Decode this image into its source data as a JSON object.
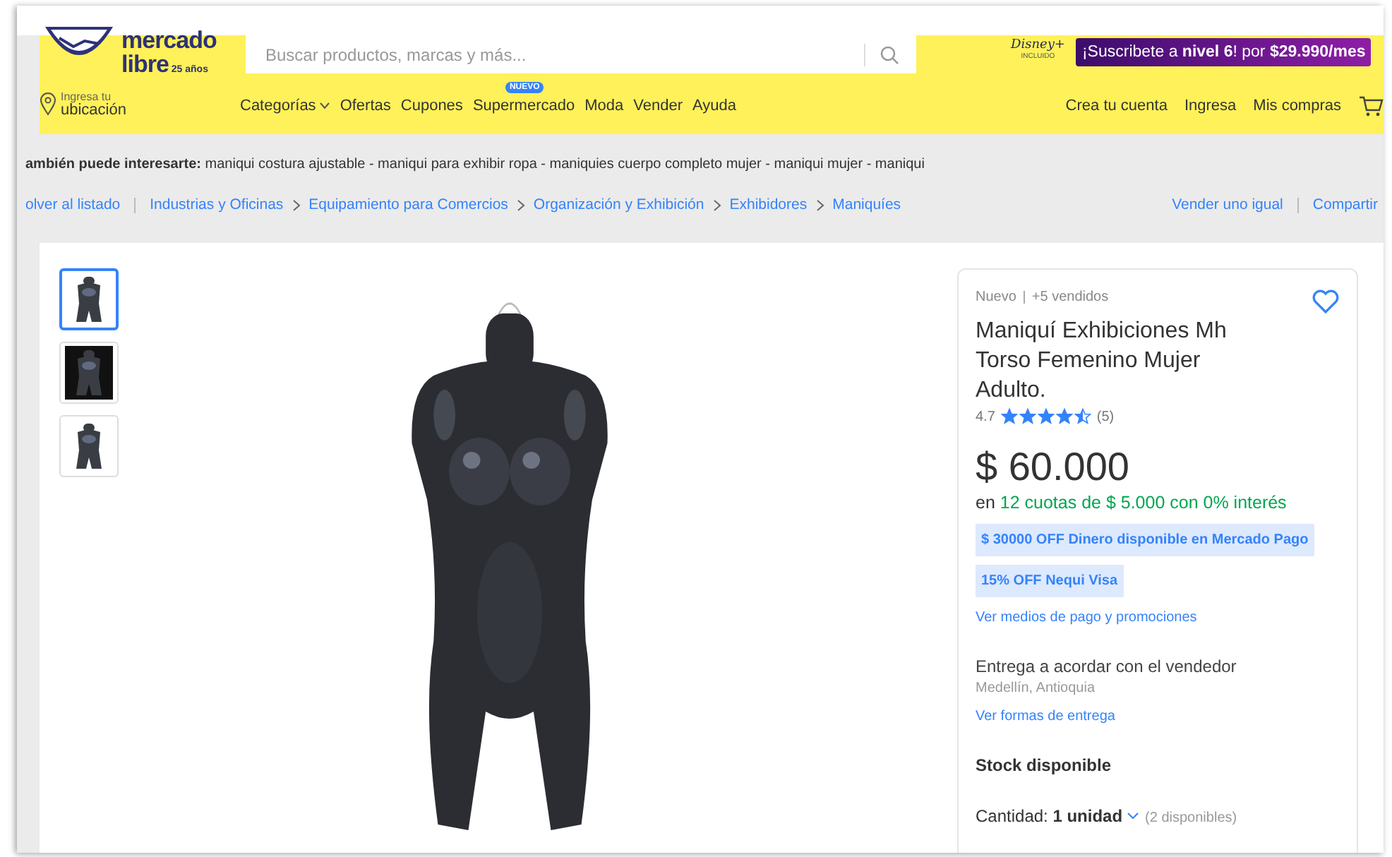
{
  "header": {
    "logo": {
      "line1": "mercado",
      "line2": "libre",
      "tag": "25 años"
    },
    "search": {
      "placeholder": "Buscar productos, marcas y más..."
    },
    "disney": {
      "name": "Disney+",
      "note": "INCLUIDO"
    },
    "subscribe": "¡Suscribete a **nivel 6**! por **$29.990/mes**",
    "location": {
      "line1": "Ingresa tu",
      "line2": "ubicación"
    },
    "nav": [
      {
        "label": "Categorías",
        "kind": "menu"
      },
      {
        "label": "Ofertas",
        "kind": "link"
      },
      {
        "label": "Cupones",
        "kind": "link"
      },
      {
        "label": "Supermercado",
        "kind": "badge",
        "badge": "NUEVO"
      },
      {
        "label": "Moda",
        "kind": "link"
      },
      {
        "label": "Vender",
        "kind": "link"
      },
      {
        "label": "Ayuda",
        "kind": "link"
      }
    ],
    "account": [
      "Crea tu cuenta",
      "Ingresa",
      "Mis compras"
    ]
  },
  "related": "**ambién puede interesarte:** maniqui costura ajustable - maniqui para exhibir ropa - maniquies cuerpo completo mujer - maniqui mujer - maniqui",
  "breadcrumb": {
    "back": "olver al listado",
    "path": [
      "Industrias y Oficinas",
      "Equipamiento para Comercios",
      "Organización y Exhibición",
      "Exhibidores",
      "Maniquíes"
    ],
    "actions": [
      "Vender uno igual",
      "Compartir"
    ]
  },
  "gallery": {
    "thumbnails": [
      {
        "kind": "picture",
        "selected": true
      },
      {
        "kind": "picture",
        "selected": false
      },
      {
        "kind": "picture",
        "selected": false
      }
    ]
  },
  "product": {
    "condition": "Nuevo",
    "sold": "+5 vendidos",
    "title": "Maniquí Exhibiciones Mh Torso Femenino Mujer Adulto.",
    "rating": "4.7",
    "stars": 4.5,
    "reviews": "(5)",
    "price": "$ 60.000",
    "installments_prefix": "en",
    "installments": "12 cuotas de $ 5.000 con 0% interés",
    "promos": [
      "$ 30000 OFF Dinero disponible en Mercado Pago",
      "15% OFF Nequi Visa"
    ],
    "payment_link": "Ver medios de pago y promociones",
    "delivery": "Entrega a acordar con el vendedor",
    "location": "Medellín, Antioquia",
    "delivery_link": "Ver formas de entrega",
    "stock": "Stock disponible",
    "quantity": "Cantidad: **1 unidad**",
    "available": "(2 disponibles)"
  }
}
